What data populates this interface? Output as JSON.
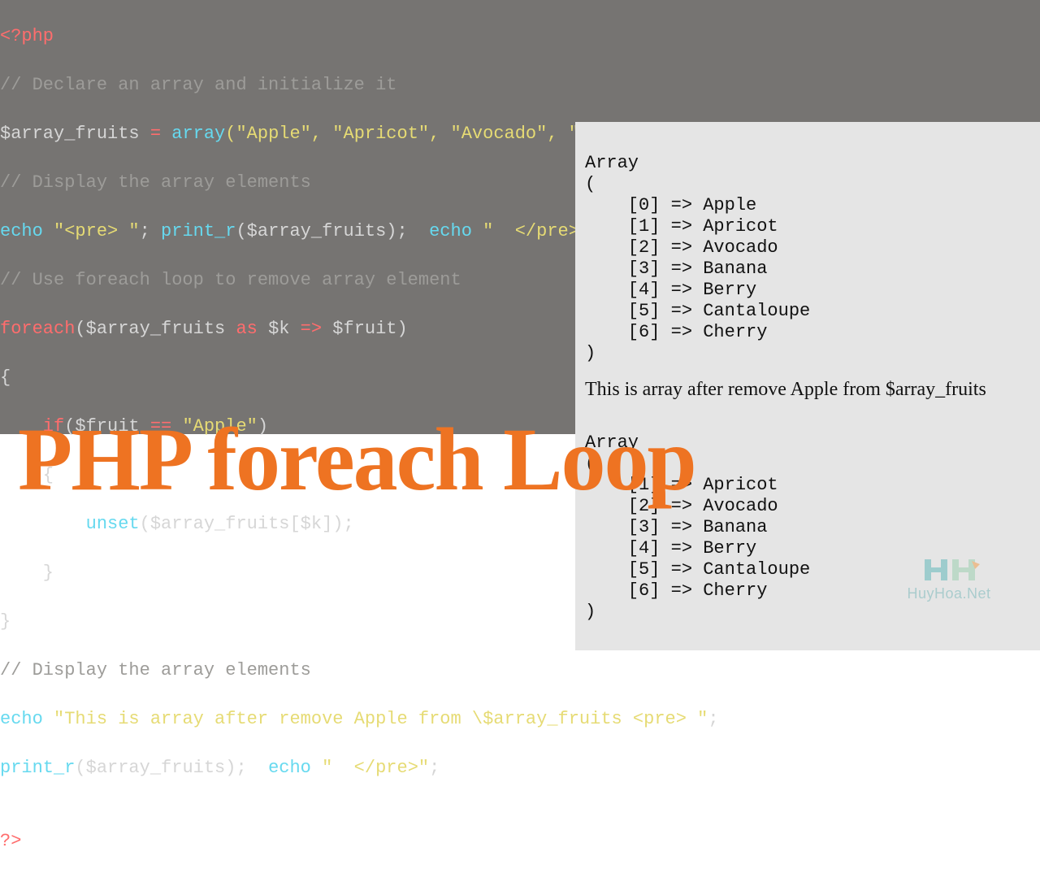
{
  "title_overlay": "PHP foreach Loop",
  "code": {
    "l1_open": "<?php",
    "l2_comment": "// Declare an array and initialize it",
    "l3_var": "$array_fruits",
    "l3_eq": " = ",
    "l3_array": "array",
    "l3_args": "(\"Apple\", \"Apricot\", \"Avocado\", \"Banana\", \"Berry\", \"Cantaloupe\", \"Cherry\"",
    "l4_comment": "// Display the array elements",
    "l5_echo1": "echo",
    "l5_str1": " \"<pre> \"",
    "l5_sep1": "; ",
    "l5_print": "print_r",
    "l5_pargs": "($array_fruits);",
    "l5_sep2": "  ",
    "l5_echo2": "echo",
    "l5_str2": " \"  </pre>\"",
    "l5_end": ";",
    "l6_comment": "// Use foreach loop to remove array element",
    "l7_foreach": "foreach",
    "l7_open": "(",
    "l7_v1": "$array_fruits",
    "l7_as": " as ",
    "l7_v2": "$k",
    "l7_arrow": " => ",
    "l7_v3": "$fruit",
    "l7_close": ")",
    "l8_brace": "{",
    "l9_if": "    if",
    "l9_cond_open": "(",
    "l9_var": "$fruit",
    "l9_eq": " == ",
    "l9_str": "\"Apple\"",
    "l9_cond_close": ")",
    "l10_brace": "    {",
    "l11_unset": "        unset",
    "l11_args": "($array_fruits[$k]);",
    "l12_brace": "    }",
    "l13_brace": "}",
    "l14_comment": "// Display the array elements",
    "l15_echo": "echo",
    "l15_str": " \"This is array after remove Apple from \\$array_fruits <pre> \"",
    "l15_end": ";",
    "l16_print": "print_r",
    "l16_args": "($array_fruits);",
    "l16_sep": "  ",
    "l16_echo": "echo",
    "l16_str": " \"  </pre>\"",
    "l16_end": ";",
    "l17_blank": "",
    "l18_close": "?>"
  },
  "output": {
    "block1": "Array\n(\n    [0] => Apple\n    [1] => Apricot\n    [2] => Avocado\n    [3] => Banana\n    [4] => Berry\n    [5] => Cantaloupe\n    [6] => Cherry\n)",
    "sentence": "This is array after remove Apple from $array_fruits",
    "block2": "Array\n(\n    [1] => Apricot\n    [2] => Avocado\n    [3] => Banana\n    [4] => Berry\n    [5] => Cantaloupe\n    [6] => Cherry\n)"
  },
  "logo_text": "HuyHoa.Net"
}
